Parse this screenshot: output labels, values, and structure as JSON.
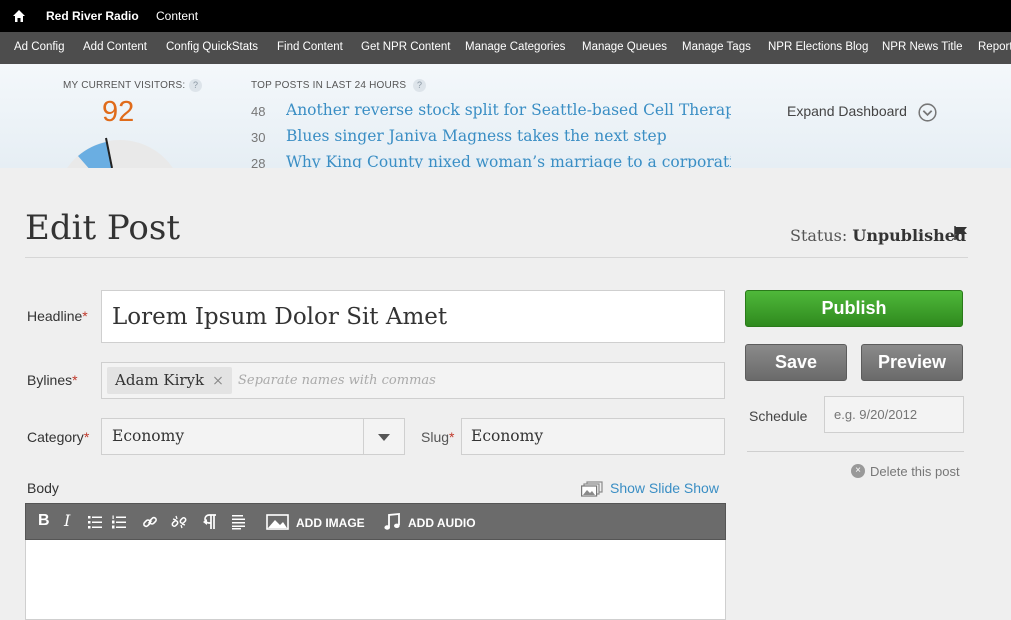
{
  "topbar": {
    "home_icon": "home-icon",
    "site_name": "Red River Radio",
    "content_link": "Content"
  },
  "shortcuts": [
    "Ad Config",
    "Add Content",
    "Config QuickStats",
    "Find Content",
    "Get NPR Content",
    "Manage Categories",
    "Manage Queues",
    "Manage Tags",
    "NPR Elections Blog",
    "NPR News Title",
    "Report"
  ],
  "dashboard": {
    "visitors_label": "MY CURRENT VISITORS:",
    "visitors_count": "92",
    "top_posts_label": "TOP POSTS IN LAST 24 HOURS",
    "help_glyph": "?",
    "posts": [
      {
        "count": "48",
        "title": "Another reverse stock split for Seattle-based Cell Therapeutics"
      },
      {
        "count": "30",
        "title": "Blues singer Janiva Magness takes the next step"
      },
      {
        "count": "28",
        "title": "Why King County nixed woman’s marriage to a corporation in"
      }
    ],
    "expand_label": "Expand Dashboard",
    "colors": {
      "visitors": "#e06b1a",
      "link": "#3a8ec4",
      "gauge": "#6aaee2"
    }
  },
  "page": {
    "title": "Edit Post",
    "status_label": "Status:",
    "status_value": "Unpublished"
  },
  "form": {
    "required_mark": "*",
    "headline_label": "Headline",
    "headline_value": "Lorem Ipsum Dolor Sit Amet",
    "bylines_label": "Bylines",
    "byline_token": "Adam Kiryk",
    "byline_remove": "×",
    "bylines_placeholder": "Separate names with commas",
    "category_label": "Category",
    "category_value": "Economy",
    "slug_label": "Slug",
    "slug_value": "Economy",
    "body_label": "Body",
    "slideshow_label": "Show Slide Show",
    "toolbar": {
      "bold": "B",
      "italic": "I",
      "add_image": "ADD IMAGE",
      "add_audio": "ADD AUDIO"
    }
  },
  "actions": {
    "publish": "Publish",
    "save": "Save",
    "preview": "Preview",
    "schedule_label": "Schedule",
    "schedule_placeholder": "e.g. 9/20/2012",
    "delete_label": "Delete this post",
    "delete_glyph": "×",
    "colors": {
      "publish": "#3a9e2a",
      "secondary": "#7a7a7a"
    }
  }
}
